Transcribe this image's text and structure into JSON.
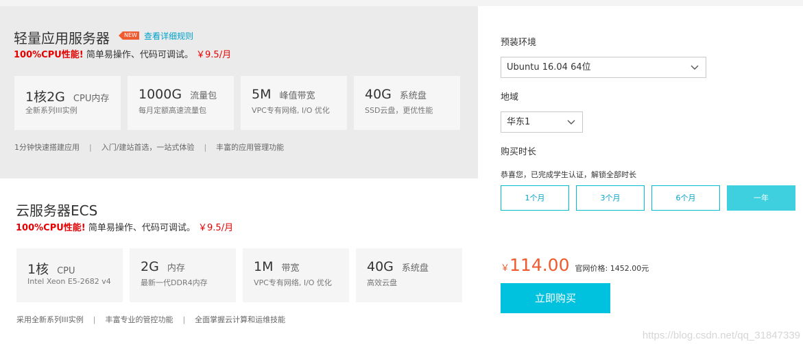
{
  "lightweight": {
    "title": "轻量应用服务器",
    "badge": "NEW",
    "rules_link": "查看详细规则",
    "promo_highlight": "100%CPU性能!",
    "promo_text": "简单易操作、代码可调试。",
    "promo_price": "￥9.5/月",
    "specs": [
      {
        "value": "1核2G",
        "unit": "CPU内存",
        "desc": "全新系列III实例"
      },
      {
        "value": "1000G",
        "unit": "流量包",
        "desc": "每月定额高速流量包"
      },
      {
        "value": "5M",
        "unit": "峰值带宽",
        "desc": "VPC专有网络, I/O 优化"
      },
      {
        "value": "40G",
        "unit": "系统盘",
        "desc": "SSD云盘，更优性能"
      }
    ],
    "features": [
      "1分钟快速搭建应用",
      "入门/建站首选，一站式体验",
      "丰富的应用管理功能"
    ],
    "separator": "|"
  },
  "ecs": {
    "title": "云服务器ECS",
    "promo_highlight": "100%CPU性能!",
    "promo_text": "简单易操作、代码可调试。",
    "promo_price": "￥9.5/月",
    "specs": [
      {
        "value": "1核",
        "unit": "CPU",
        "desc": "Intel Xeon E5-2682 v4"
      },
      {
        "value": "2G",
        "unit": "内存",
        "desc": "最新一代DDR4内存"
      },
      {
        "value": "1M",
        "unit": "带宽",
        "desc": "VPC专有网络, I/O 优化"
      },
      {
        "value": "40G",
        "unit": "系统盘",
        "desc": "高效云盘"
      }
    ],
    "features": [
      "采用全新系列III实例",
      "丰富专业的管控功能",
      "全面掌握云计算和运维技能"
    ],
    "separator": "|"
  },
  "order": {
    "os_label": "预装环境",
    "os_value": "Ubuntu 16.04 64位",
    "region_label": "地域",
    "region_value": "华东1",
    "duration_label": "购买时长",
    "notice": "恭喜您，已完成学生认证，解锁全部时长",
    "durations": [
      "1个月",
      "3个月",
      "6个月",
      "一年"
    ],
    "selected_duration": "一年",
    "currency": "￥",
    "price": "114.00",
    "official_price": "官网价格: 1452.00元",
    "buy_label": "立即购买"
  },
  "watermark": "https://blog.csdn.net/qq_31847339",
  "colors": {
    "accent": "#00c1de",
    "price": "#ef5a2f",
    "promo_red": "#e50000",
    "link": "#00a2ca"
  }
}
